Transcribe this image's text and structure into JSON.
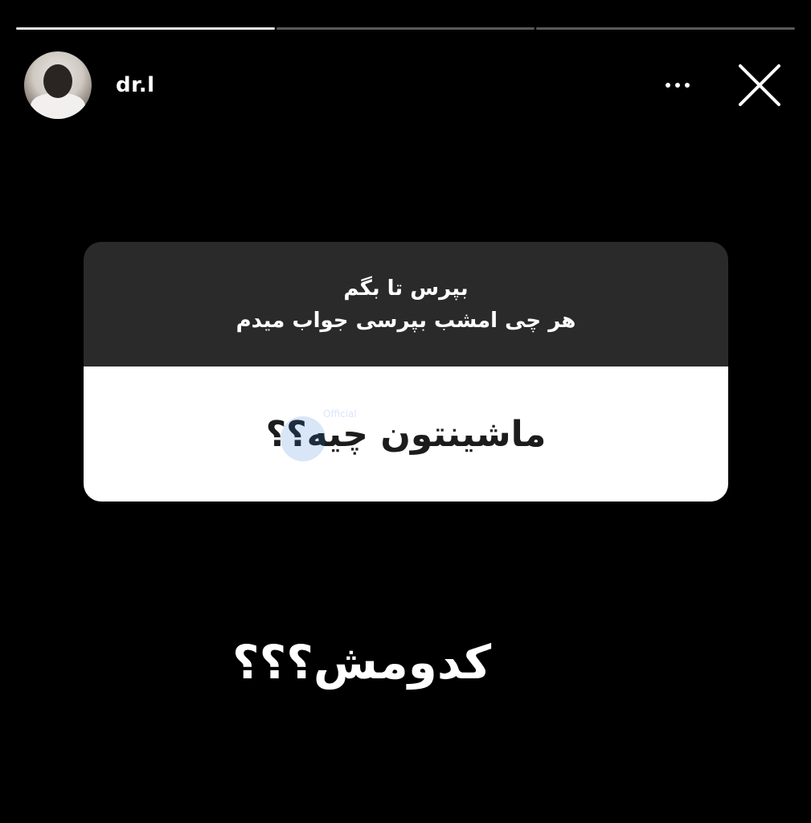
{
  "progress": {
    "total_segments": 3,
    "completed_segments": 1
  },
  "header": {
    "username": "dr.l",
    "more_icon": "more-horizontal-icon",
    "close_icon": "close-icon"
  },
  "question_card": {
    "prompt_line_1": "بپرس تا بگم",
    "prompt_line_2": "هر چی امشب بپرسی جواب میدم",
    "question": "ماشینتون چیه؟؟",
    "watermark_text": "Official"
  },
  "answer_text": "کدومش؟؟؟",
  "colors": {
    "background": "#000000",
    "card_header": "#2a2a2a",
    "card_body": "#ffffff",
    "text_light": "#ffffff",
    "text_dark": "#1c1c1c"
  }
}
